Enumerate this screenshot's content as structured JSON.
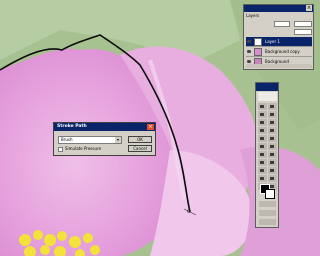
{
  "layers_panel": {
    "tab_label": "Layers",
    "close_glyph": "×",
    "rows": [
      {
        "name": "Layer 1",
        "selected": true
      },
      {
        "name": "Background copy",
        "selected": false
      },
      {
        "name": "Background",
        "selected": false
      }
    ]
  },
  "stroke_path_dialog": {
    "title": "Stroke Path",
    "close_glyph": "×",
    "tool_value": "Brush",
    "dropdown_glyph": "▾",
    "simulate_pressure_label": "Simulate Pressure",
    "ok_label": "OK",
    "cancel_label": "Cancel"
  },
  "icons": [
    "eye-icon",
    "feather-icon",
    "close-icon",
    "chevron-down-icon"
  ],
  "colors": {
    "selection": "#0a246a",
    "panel": "#d4d0c8",
    "close_button": "#e0502c"
  }
}
